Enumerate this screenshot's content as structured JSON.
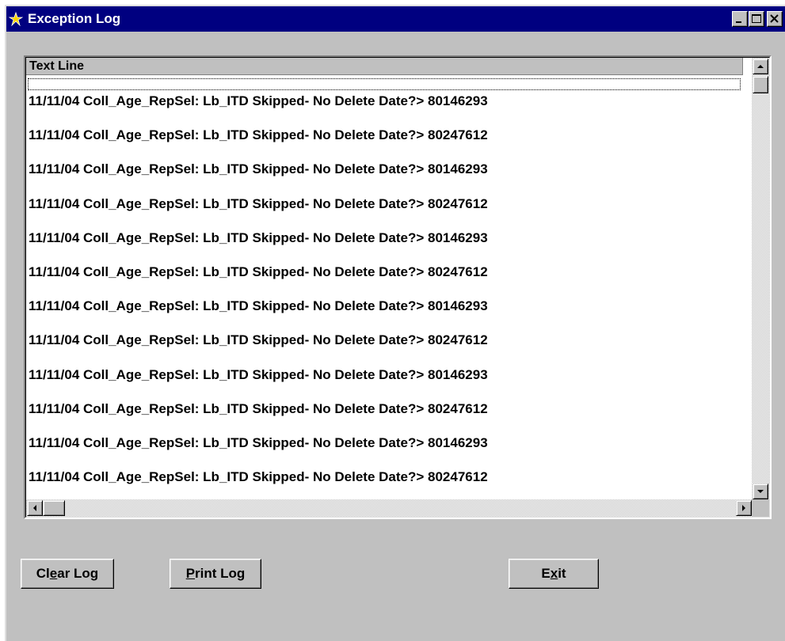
{
  "window": {
    "title": "Exception Log",
    "controls": [
      "minimize-icon",
      "maximize-icon",
      "close-icon"
    ],
    "title_bar_color": "#000080",
    "face_color": "#c0c0c0"
  },
  "log_table": {
    "column_header": "Text Line",
    "rows": [
      "",
      "11/11/04 Coll_Age_RepSel: Lb_ITD Skipped- No Delete Date?> 80146293",
      "11/11/04 Coll_Age_RepSel: Lb_ITD Skipped- No Delete Date?> 80247612",
      "11/11/04 Coll_Age_RepSel: Lb_ITD Skipped- No Delete Date?> 80146293",
      "11/11/04 Coll_Age_RepSel: Lb_ITD Skipped- No Delete Date?> 80247612",
      "11/11/04 Coll_Age_RepSel: Lb_ITD Skipped- No Delete Date?> 80146293",
      "11/11/04 Coll_Age_RepSel: Lb_ITD Skipped- No Delete Date?> 80247612",
      "11/11/04 Coll_Age_RepSel: Lb_ITD Skipped- No Delete Date?> 80146293",
      "11/11/04 Coll_Age_RepSel: Lb_ITD Skipped- No Delete Date?> 80247612",
      "11/11/04 Coll_Age_RepSel: Lb_ITD Skipped- No Delete Date?> 80146293",
      "11/11/04 Coll_Age_RepSel: Lb_ITD Skipped- No Delete Date?> 80247612",
      "11/11/04 Coll_Age_RepSel: Lb_ITD Skipped- No Delete Date?> 80146293",
      "11/11/04 Coll_Age_RepSel: Lb_ITD Skipped- No Delete Date?> 80247612"
    ]
  },
  "buttons": {
    "clear_log": {
      "before": "Cl",
      "mnemonic": "e",
      "after": "ar Log"
    },
    "print_log": {
      "before": "",
      "mnemonic": "P",
      "after": "rint Log"
    },
    "exit": {
      "before": "E",
      "mnemonic": "x",
      "after": "it"
    }
  }
}
